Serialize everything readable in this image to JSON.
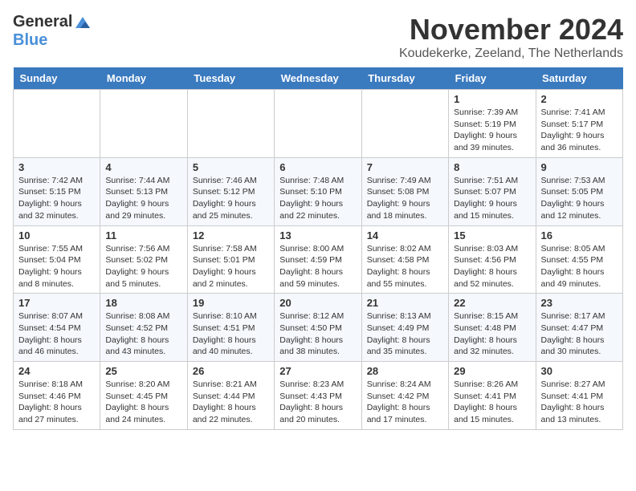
{
  "header": {
    "logo_general": "General",
    "logo_blue": "Blue",
    "month_title": "November 2024",
    "location": "Koudekerke, Zeeland, The Netherlands"
  },
  "days_of_week": [
    "Sunday",
    "Monday",
    "Tuesday",
    "Wednesday",
    "Thursday",
    "Friday",
    "Saturday"
  ],
  "weeks": [
    [
      {
        "day": "",
        "info": ""
      },
      {
        "day": "",
        "info": ""
      },
      {
        "day": "",
        "info": ""
      },
      {
        "day": "",
        "info": ""
      },
      {
        "day": "",
        "info": ""
      },
      {
        "day": "1",
        "info": "Sunrise: 7:39 AM\nSunset: 5:19 PM\nDaylight: 9 hours and 39 minutes."
      },
      {
        "day": "2",
        "info": "Sunrise: 7:41 AM\nSunset: 5:17 PM\nDaylight: 9 hours and 36 minutes."
      }
    ],
    [
      {
        "day": "3",
        "info": "Sunrise: 7:42 AM\nSunset: 5:15 PM\nDaylight: 9 hours and 32 minutes."
      },
      {
        "day": "4",
        "info": "Sunrise: 7:44 AM\nSunset: 5:13 PM\nDaylight: 9 hours and 29 minutes."
      },
      {
        "day": "5",
        "info": "Sunrise: 7:46 AM\nSunset: 5:12 PM\nDaylight: 9 hours and 25 minutes."
      },
      {
        "day": "6",
        "info": "Sunrise: 7:48 AM\nSunset: 5:10 PM\nDaylight: 9 hours and 22 minutes."
      },
      {
        "day": "7",
        "info": "Sunrise: 7:49 AM\nSunset: 5:08 PM\nDaylight: 9 hours and 18 minutes."
      },
      {
        "day": "8",
        "info": "Sunrise: 7:51 AM\nSunset: 5:07 PM\nDaylight: 9 hours and 15 minutes."
      },
      {
        "day": "9",
        "info": "Sunrise: 7:53 AM\nSunset: 5:05 PM\nDaylight: 9 hours and 12 minutes."
      }
    ],
    [
      {
        "day": "10",
        "info": "Sunrise: 7:55 AM\nSunset: 5:04 PM\nDaylight: 9 hours and 8 minutes."
      },
      {
        "day": "11",
        "info": "Sunrise: 7:56 AM\nSunset: 5:02 PM\nDaylight: 9 hours and 5 minutes."
      },
      {
        "day": "12",
        "info": "Sunrise: 7:58 AM\nSunset: 5:01 PM\nDaylight: 9 hours and 2 minutes."
      },
      {
        "day": "13",
        "info": "Sunrise: 8:00 AM\nSunset: 4:59 PM\nDaylight: 8 hours and 59 minutes."
      },
      {
        "day": "14",
        "info": "Sunrise: 8:02 AM\nSunset: 4:58 PM\nDaylight: 8 hours and 55 minutes."
      },
      {
        "day": "15",
        "info": "Sunrise: 8:03 AM\nSunset: 4:56 PM\nDaylight: 8 hours and 52 minutes."
      },
      {
        "day": "16",
        "info": "Sunrise: 8:05 AM\nSunset: 4:55 PM\nDaylight: 8 hours and 49 minutes."
      }
    ],
    [
      {
        "day": "17",
        "info": "Sunrise: 8:07 AM\nSunset: 4:54 PM\nDaylight: 8 hours and 46 minutes."
      },
      {
        "day": "18",
        "info": "Sunrise: 8:08 AM\nSunset: 4:52 PM\nDaylight: 8 hours and 43 minutes."
      },
      {
        "day": "19",
        "info": "Sunrise: 8:10 AM\nSunset: 4:51 PM\nDaylight: 8 hours and 40 minutes."
      },
      {
        "day": "20",
        "info": "Sunrise: 8:12 AM\nSunset: 4:50 PM\nDaylight: 8 hours and 38 minutes."
      },
      {
        "day": "21",
        "info": "Sunrise: 8:13 AM\nSunset: 4:49 PM\nDaylight: 8 hours and 35 minutes."
      },
      {
        "day": "22",
        "info": "Sunrise: 8:15 AM\nSunset: 4:48 PM\nDaylight: 8 hours and 32 minutes."
      },
      {
        "day": "23",
        "info": "Sunrise: 8:17 AM\nSunset: 4:47 PM\nDaylight: 8 hours and 30 minutes."
      }
    ],
    [
      {
        "day": "24",
        "info": "Sunrise: 8:18 AM\nSunset: 4:46 PM\nDaylight: 8 hours and 27 minutes."
      },
      {
        "day": "25",
        "info": "Sunrise: 8:20 AM\nSunset: 4:45 PM\nDaylight: 8 hours and 24 minutes."
      },
      {
        "day": "26",
        "info": "Sunrise: 8:21 AM\nSunset: 4:44 PM\nDaylight: 8 hours and 22 minutes."
      },
      {
        "day": "27",
        "info": "Sunrise: 8:23 AM\nSunset: 4:43 PM\nDaylight: 8 hours and 20 minutes."
      },
      {
        "day": "28",
        "info": "Sunrise: 8:24 AM\nSunset: 4:42 PM\nDaylight: 8 hours and 17 minutes."
      },
      {
        "day": "29",
        "info": "Sunrise: 8:26 AM\nSunset: 4:41 PM\nDaylight: 8 hours and 15 minutes."
      },
      {
        "day": "30",
        "info": "Sunrise: 8:27 AM\nSunset: 4:41 PM\nDaylight: 8 hours and 13 minutes."
      }
    ]
  ]
}
